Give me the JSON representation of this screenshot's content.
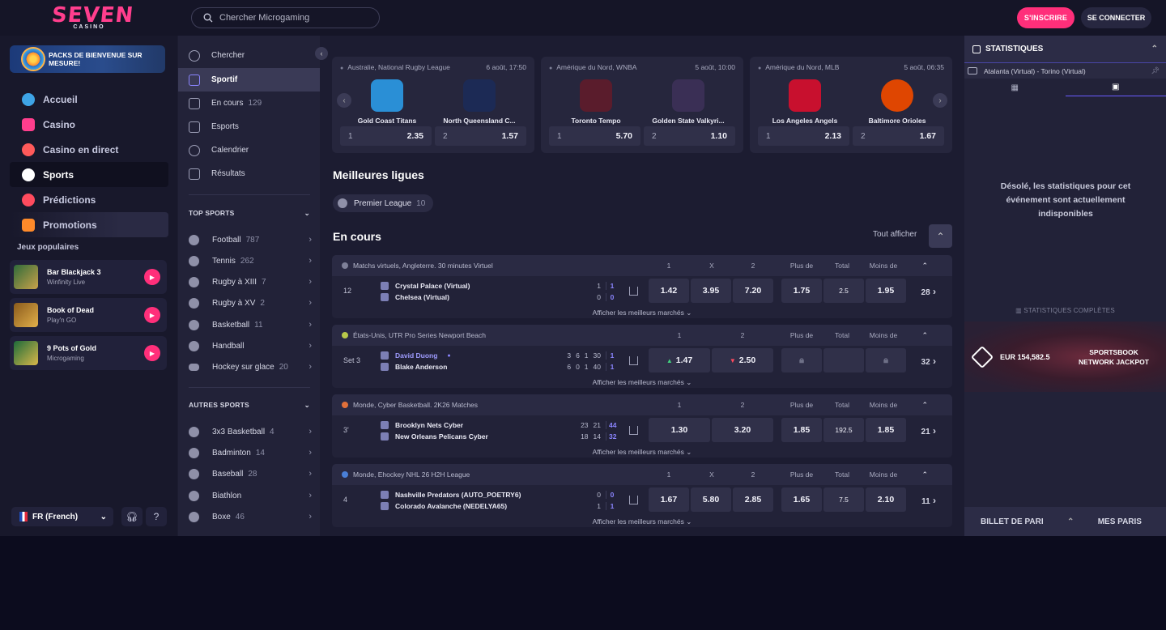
{
  "header": {
    "logo_main": "SEVEN",
    "logo_sub": "CASINO",
    "search_placeholder": "Chercher Microgaming",
    "signup_label": "S'INSCRIRE",
    "login_label": "SE CONNECTER"
  },
  "sidebar": {
    "promo_banner": "PACKS DE BIENVENUE SUR MESURE!",
    "items": [
      {
        "label": "Accueil",
        "icon": "flower-icon",
        "color": "#3ea4e6"
      },
      {
        "label": "Casino",
        "icon": "seven-icon",
        "color": "#ff3e8d"
      },
      {
        "label": "Casino en direct",
        "icon": "chip-icon",
        "color": "#ff5a5a"
      },
      {
        "label": "Sports",
        "icon": "soccer-ball-icon",
        "color": "#ffffff"
      },
      {
        "label": "Prédictions",
        "icon": "rugby-ball-icon",
        "color": "#ff4b5e"
      },
      {
        "label": "Promotions",
        "icon": "gift-icon",
        "color": "#ff8a2a"
      }
    ],
    "popular_title": "Jeux populaires",
    "games": [
      {
        "name": "Bar Blackjack 3",
        "provider": "Winfinity Live"
      },
      {
        "name": "Book of Dead",
        "provider": "Play'n GO"
      },
      {
        "name": "9 Pots of Gold",
        "provider": "Microgaming"
      }
    ],
    "language": "FR (French)"
  },
  "sports_nav": {
    "items": [
      {
        "label": "Chercher",
        "count": ""
      },
      {
        "label": "Sportif",
        "count": ""
      },
      {
        "label": "En cours",
        "count": "129"
      },
      {
        "label": "Esports",
        "count": ""
      },
      {
        "label": "Calendrier",
        "count": ""
      },
      {
        "label": "Résultats",
        "count": ""
      }
    ],
    "top_sports_title": "TOP SPORTS",
    "top_sports": [
      {
        "label": "Football",
        "count": "787"
      },
      {
        "label": "Tennis",
        "count": "262"
      },
      {
        "label": "Rugby à XIII",
        "count": "7"
      },
      {
        "label": "Rugby à XV",
        "count": "2"
      },
      {
        "label": "Basketball",
        "count": "11"
      },
      {
        "label": "Handball",
        "count": ""
      },
      {
        "label": "Hockey sur glace",
        "count": "20"
      }
    ],
    "other_sports_title": "AUTRES SPORTS",
    "other_sports": [
      {
        "label": "3x3 Basketball",
        "count": "4"
      },
      {
        "label": "Badminton",
        "count": "14"
      },
      {
        "label": "Baseball",
        "count": "28"
      },
      {
        "label": "Biathlon",
        "count": ""
      },
      {
        "label": "Boxe",
        "count": "46"
      }
    ]
  },
  "featured": [
    {
      "league": "Australie, National Rugby League",
      "time": "6 août, 17:50",
      "home": "Gold Coast Titans",
      "away": "North Queensland C...",
      "o1_label": "1",
      "o1": "2.35",
      "o2_label": "2",
      "o2": "1.57",
      "home_color": "#2a8fd6",
      "away_color": "#1c2a55"
    },
    {
      "league": "Amérique du Nord, WNBA",
      "time": "5 août, 10:00",
      "home": "Toronto Tempo",
      "away": "Golden State Valkyri...",
      "o1_label": "1",
      "o1": "5.70",
      "o2_label": "2",
      "o2": "1.10",
      "home_color": "#5a1c2c",
      "away_color": "#3a2f55"
    },
    {
      "league": "Amérique du Nord, MLB",
      "time": "5 août, 06:35",
      "home": "Los Angeles Angels",
      "away": "Baltimore Orioles",
      "o1_label": "1",
      "o1": "2.13",
      "o2_label": "2",
      "o2": "1.67",
      "home_color": "#c8102e",
      "away_color": "#df4601"
    }
  ],
  "best_leagues_title": "Meilleures ligues",
  "best_league_chip": {
    "label": "Premier League",
    "count": "10"
  },
  "live_title": "En cours",
  "show_all": "Tout afficher",
  "more_markets": "Afficher les meilleurs marchés",
  "events": [
    {
      "league": "Matchs virtuels, Angleterre. 30 minutes Virtuel",
      "cols": [
        "1",
        "X",
        "2",
        "Plus de",
        "Total",
        "Moins de"
      ],
      "status": "12",
      "home": "Crystal Palace (Virtual)",
      "away": "Chelsea (Virtual)",
      "score_home": [
        "1",
        "1"
      ],
      "score_away": [
        "0",
        "0"
      ],
      "odds": [
        "1.42",
        "3.95",
        "7.20"
      ],
      "over": "1.75",
      "total": "2.5",
      "under": "1.95",
      "more": "28"
    },
    {
      "league": "États-Unis, UTR Pro Series Newport Beach",
      "cols": [
        "1",
        "2",
        "Plus de",
        "Total",
        "Moins de"
      ],
      "status": "Set 3",
      "home": "David Duong",
      "away": "Blake Anderson",
      "score_home": [
        "3",
        "6",
        "1",
        "30",
        "1"
      ],
      "score_away": [
        "6",
        "0",
        "1",
        "40",
        "1"
      ],
      "odds": [
        "1.47",
        "2.50"
      ],
      "more": "32"
    },
    {
      "league": "Monde, Cyber Basketball. 2K26 Matches",
      "cols": [
        "1",
        "2",
        "Plus de",
        "Total",
        "Moins de"
      ],
      "status": "3'",
      "home": "Brooklyn Nets Cyber",
      "away": "New Orleans Pelicans Cyber",
      "score_home": [
        "23",
        "21",
        "44"
      ],
      "score_away": [
        "18",
        "14",
        "32"
      ],
      "odds": [
        "1.30",
        "3.20"
      ],
      "over": "1.85",
      "total": "192.5",
      "under": "1.85",
      "more": "21"
    },
    {
      "league": "Monde, Ehockey NHL 26 H2H League",
      "cols": [
        "1",
        "X",
        "2",
        "Plus de",
        "Total",
        "Moins de"
      ],
      "status": "4",
      "home": "Nashville Predators (AUTO_POETRY6)",
      "away": "Colorado Avalanche (NEDELYA65)",
      "score_home": [
        "0",
        "0"
      ],
      "score_away": [
        "1",
        "1"
      ],
      "odds": [
        "1.67",
        "5.80",
        "2.85"
      ],
      "over": "1.65",
      "total": "7.5",
      "under": "2.10",
      "more": "11"
    }
  ],
  "right_panel": {
    "title": "STATISTIQUES",
    "match": "Atalanta (Virtual) - Torino (Virtual)",
    "message": "Désolé, les statistiques pour cet événement sont actuellement indisponibles",
    "full_stats": "STATISTIQUES COMPLÈTES",
    "jackpot_amount": "EUR 154,582.5",
    "jackpot_name": "SPORTSBOOK NETWORK JACKPOT",
    "betslip": "BILLET DE PARI",
    "my_bets": "MES PARIS"
  }
}
